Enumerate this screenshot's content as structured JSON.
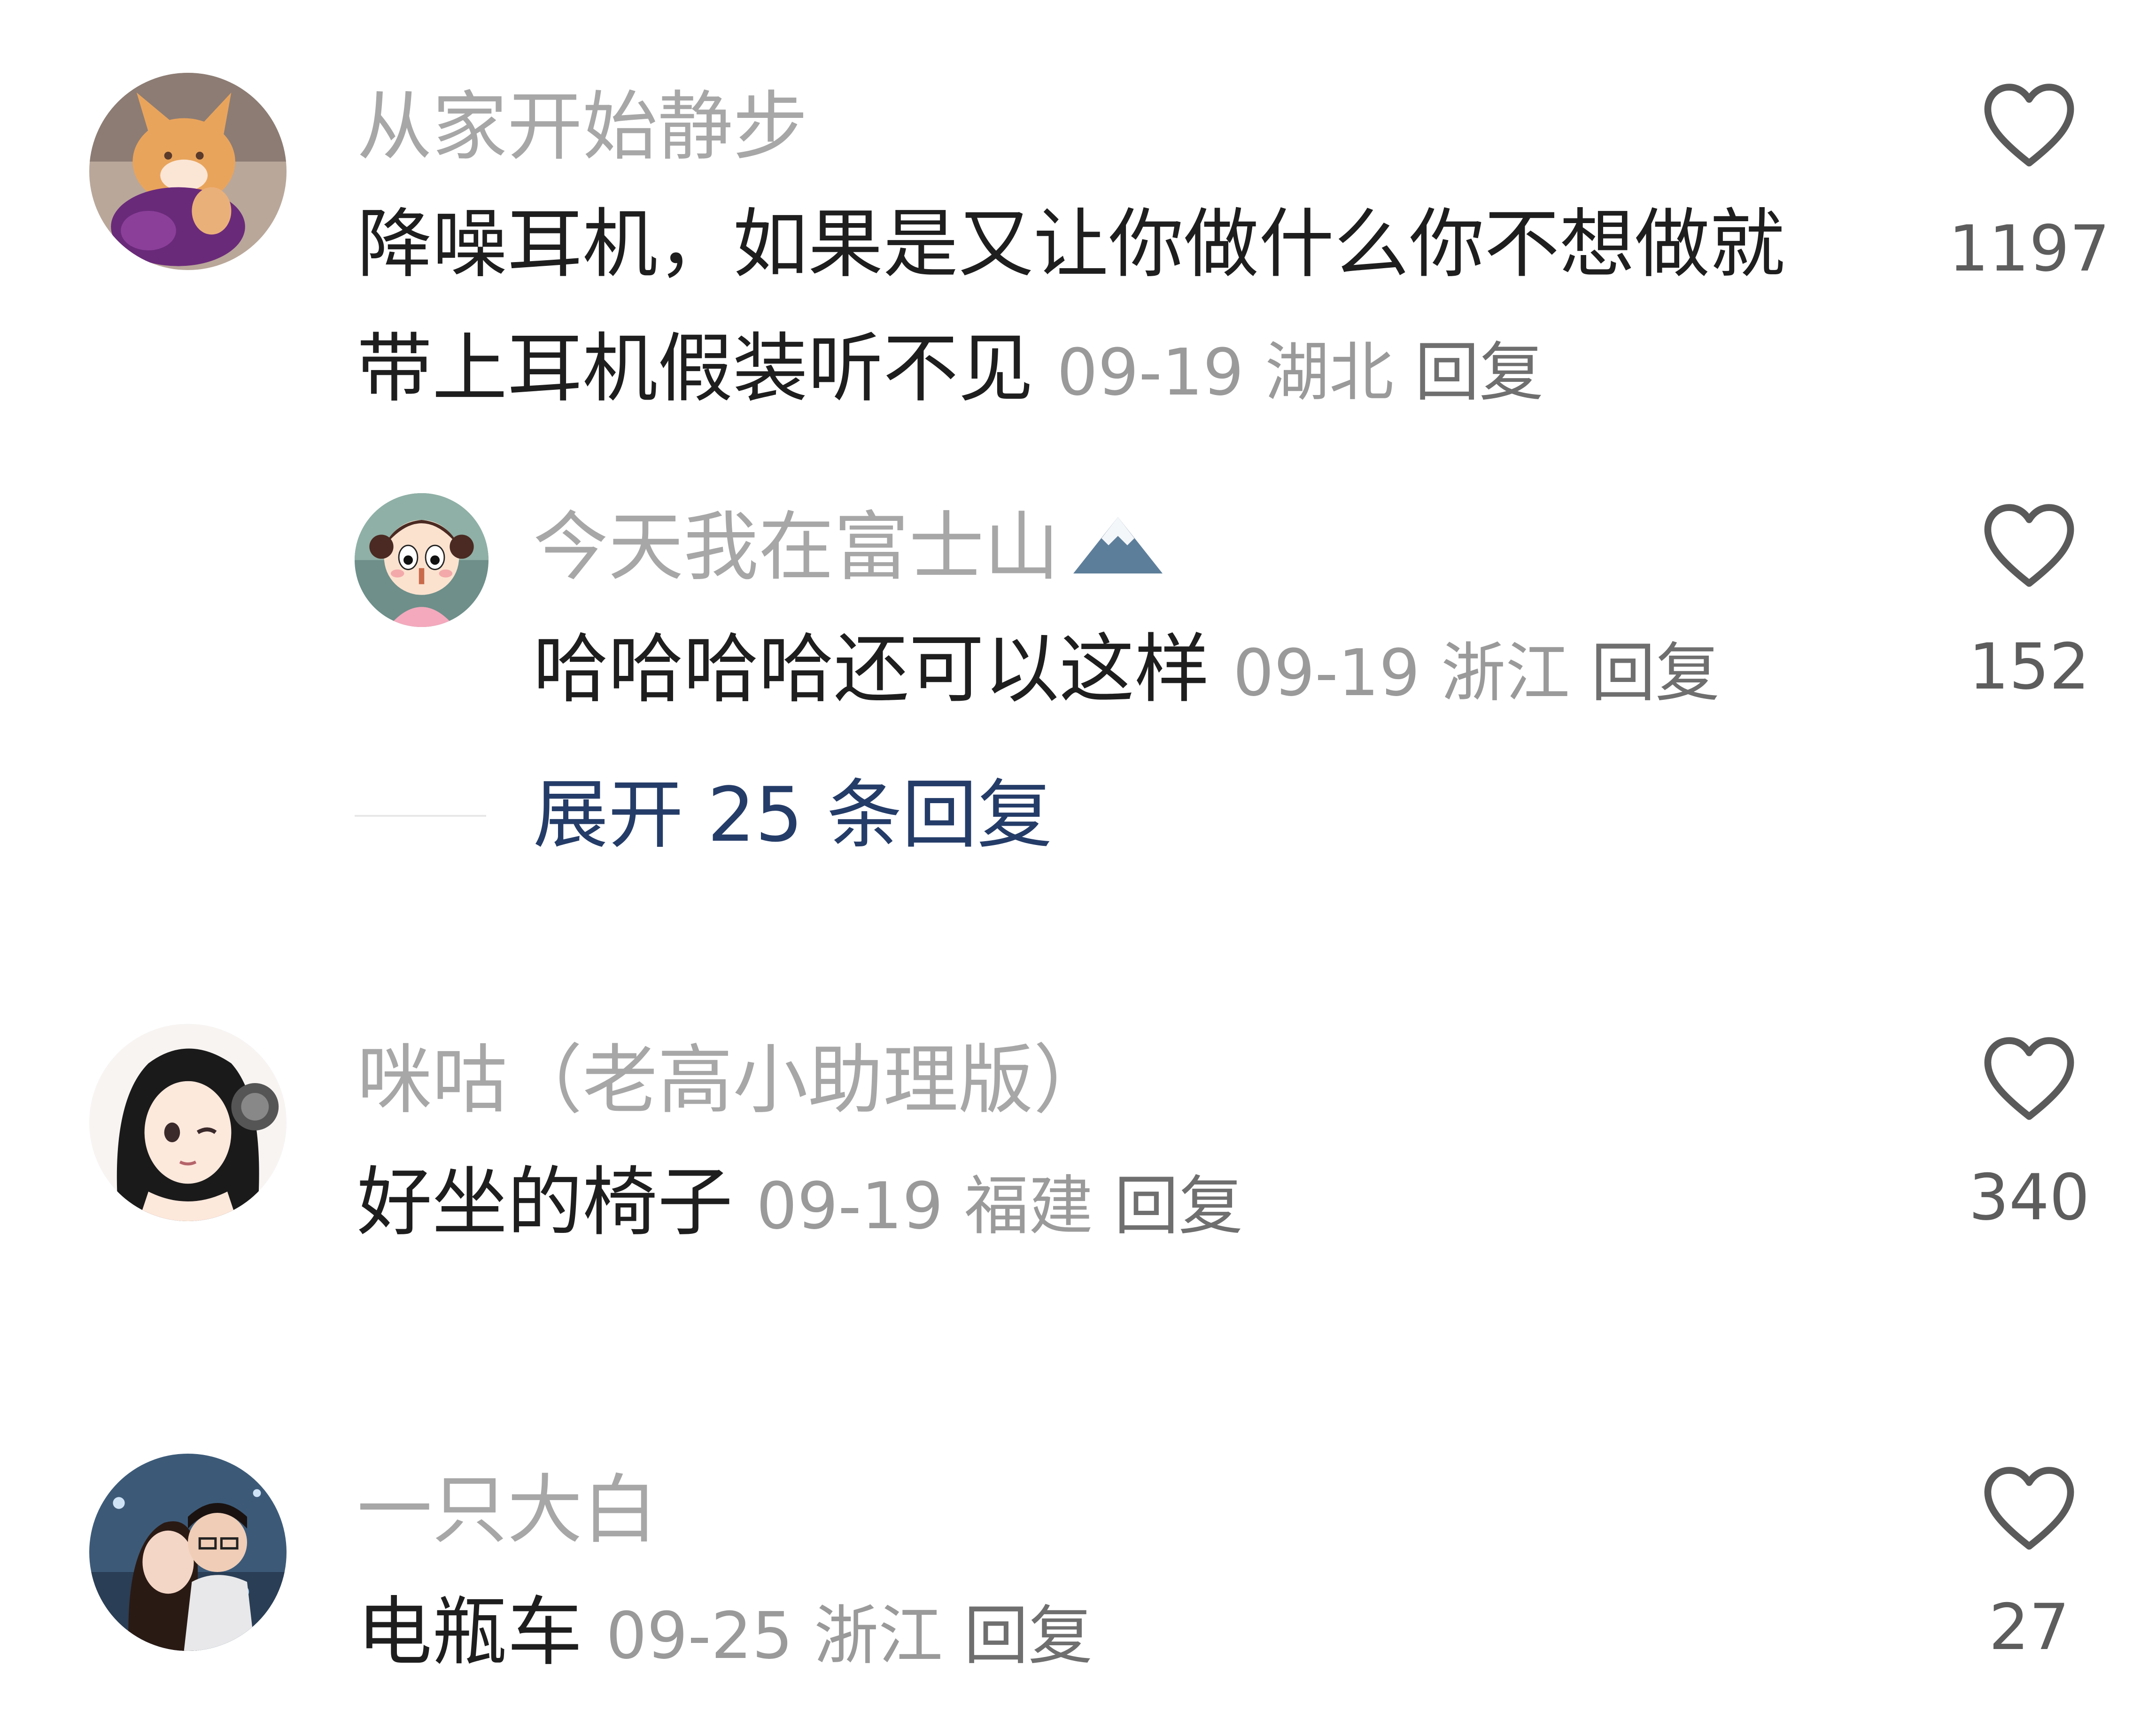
{
  "comments": [
    {
      "username": "从家开始静步",
      "text_line1": "降噪耳机，如果是又让你做什么你不想做就",
      "text_line2": "带上耳机假装听不见",
      "date": "09-19",
      "location": "湖北",
      "reply_label": "回复",
      "likes": "1197",
      "avatar_icon": "cat-avatar"
    },
    {
      "username": "今天我在富士山",
      "username_emoji": "🗻",
      "text": "哈哈哈哈还可以这样",
      "date": "09-19",
      "location": "浙江",
      "reply_label": "回复",
      "likes": "152",
      "avatar_icon": "cartoon-girl-avatar"
    },
    {
      "username": "咪咕（老高小助理版）",
      "text": "好坐的椅子",
      "date": "09-19",
      "location": "福建",
      "reply_label": "回复",
      "likes": "340",
      "avatar_icon": "anime-headphones-avatar"
    },
    {
      "username": "一只大白",
      "text": "电瓶车",
      "date": "09-25",
      "location": "浙江",
      "reply_label": "回复",
      "likes": "27",
      "avatar_icon": "couple-photo-avatar"
    }
  ],
  "expand_replies": {
    "label": "展开 25 条回复"
  },
  "colors": {
    "username": "#a7a7a7",
    "text": "#1e1e1e",
    "meta": "#9a9a9a",
    "expand": "#243c68",
    "heart": "#5a5a5a"
  }
}
